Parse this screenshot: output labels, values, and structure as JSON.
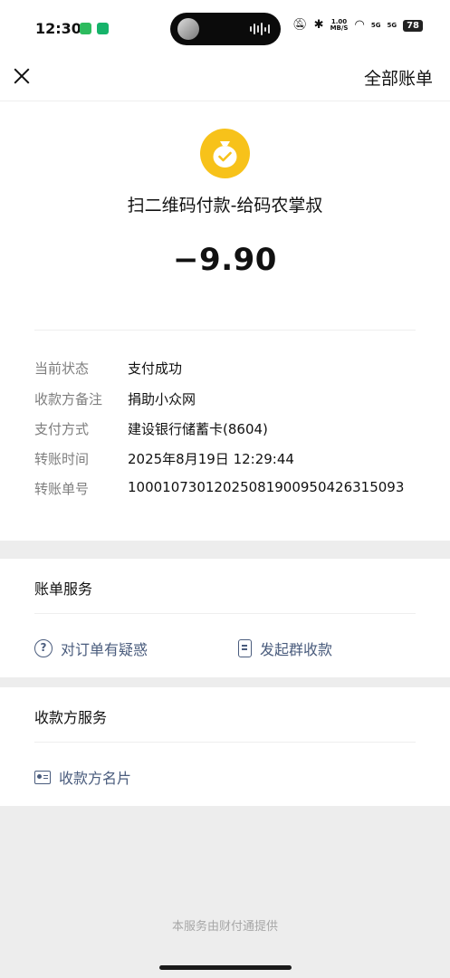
{
  "status_bar": {
    "time": "12:30",
    "speed": "1.00\nMB/S",
    "signal1": "5G",
    "signal2": "5G",
    "battery": "78"
  },
  "header": {
    "all_bills_label": "全部账单"
  },
  "transaction": {
    "merchant": "扫二维码付款-给码农掌叔",
    "amount": "−9.90",
    "details": [
      {
        "key": "当前状态",
        "value": "支付成功"
      },
      {
        "key": "收款方备注",
        "value": "捐助小众网"
      },
      {
        "key": "支付方式",
        "value": "建设银行储蓄卡(8604)"
      },
      {
        "key": "转账时间",
        "value": "2025年8月19日 12:29:44"
      },
      {
        "key": "转账单号",
        "value": "100010730120250819009504263150​93"
      }
    ]
  },
  "bill_service": {
    "title": "账单服务",
    "question_label": "对订单有疑惑",
    "group_collect_label": "发起群收款"
  },
  "payee_service": {
    "title": "收款方服务",
    "payee_card_label": "收款方名片"
  },
  "footer": "本服务由财付通提供",
  "colors": {
    "coin": "#f7c21a",
    "link": "#4a5c7d",
    "background": "#ededed"
  }
}
